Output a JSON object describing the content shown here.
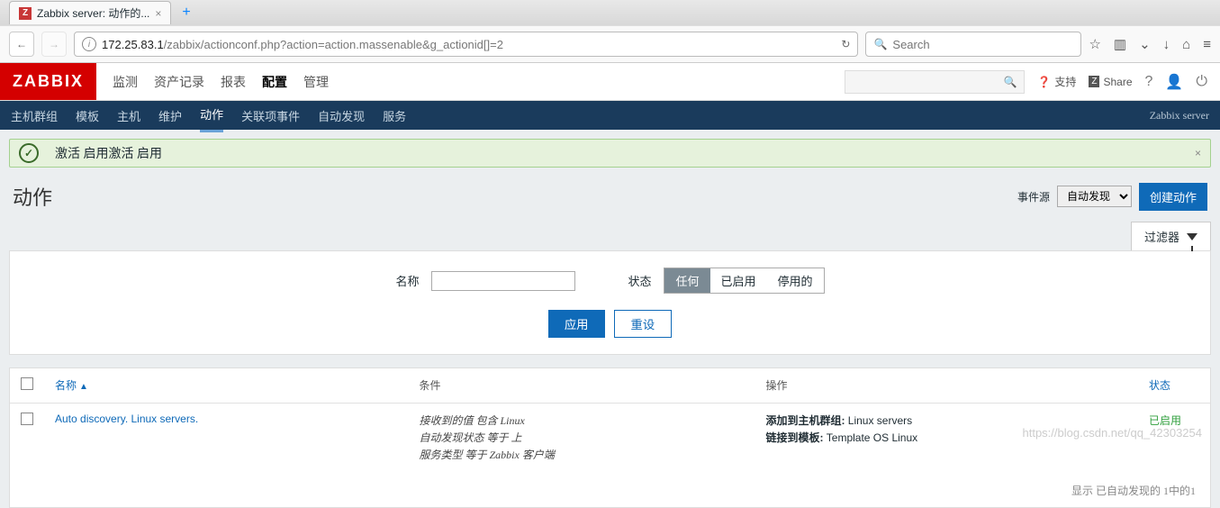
{
  "browser": {
    "tab_title": "Zabbix server: 动作的...",
    "url_host": "172.25.83.1",
    "url_path": "/zabbix/actionconf.php?action=action.massenable&g_actionid[]=2",
    "search_placeholder": "Search"
  },
  "header": {
    "logo": "ZABBIX",
    "menu": [
      "监测",
      "资产记录",
      "报表",
      "配置",
      "管理"
    ],
    "menu_active_index": 3,
    "support": "支持",
    "share": "Share",
    "server_label": "Zabbix server"
  },
  "subnav": {
    "items": [
      "主机群组",
      "模板",
      "主机",
      "维护",
      "动作",
      "关联项事件",
      "自动发现",
      "服务"
    ],
    "active_index": 4
  },
  "alert": {
    "text": "激活 启用激活 启用"
  },
  "page": {
    "title": "动作",
    "event_source_label": "事件源",
    "event_source_value": "自动发现",
    "create_button": "创建动作",
    "filter_tab": "过滤器"
  },
  "filter": {
    "name_label": "名称",
    "status_label": "状态",
    "seg": [
      "任何",
      "已启用",
      "停用的"
    ],
    "seg_active": 0,
    "apply": "应用",
    "reset": "重设"
  },
  "table": {
    "headers": {
      "name": "名称",
      "condition": "条件",
      "operation": "操作",
      "status": "状态"
    },
    "rows": [
      {
        "name": "Auto discovery. Linux servers.",
        "conditions": [
          "接收到的值 包含 Linux",
          "自动发现状态 等于 上",
          "服务类型 等于 Zabbix 客户端"
        ],
        "operations": [
          {
            "label": "添加到主机群组:",
            "value": "Linux servers"
          },
          {
            "label": "链接到模板:",
            "value": "Template OS Linux"
          }
        ],
        "status": "已启用"
      }
    ],
    "footer": "显示 已自动发现的 1中的1"
  },
  "watermark": "https://blog.csdn.net/qq_42303254"
}
